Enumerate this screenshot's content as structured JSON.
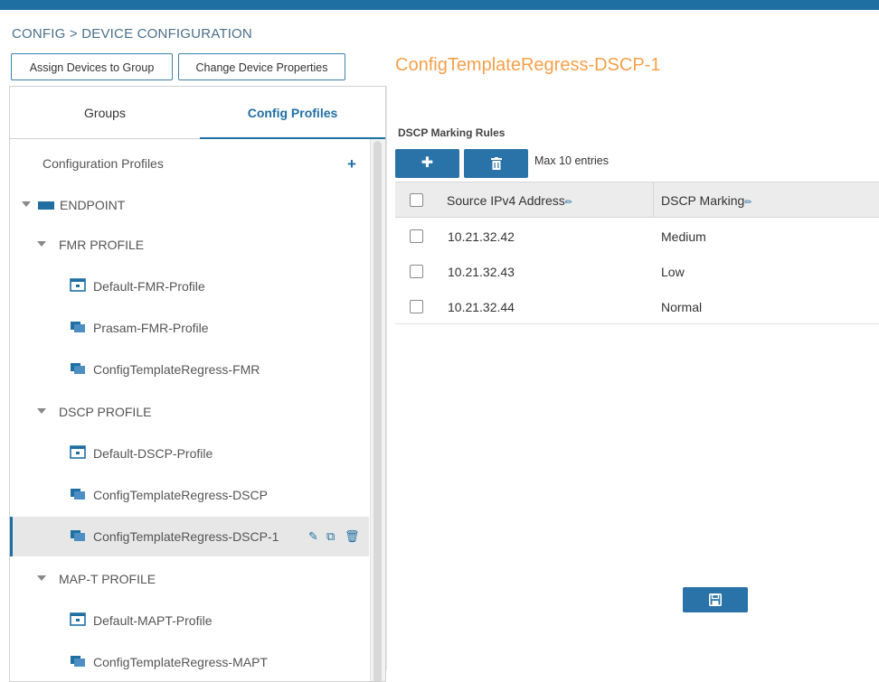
{
  "breadcrumb": "CONFIG > DEVICE CONFIGURATION",
  "toolbar": {
    "assign_label": "Assign Devices to Group",
    "change_label": "Change Device Properties"
  },
  "page_title": "ConfigTemplateRegress-DSCP-1",
  "tabs": {
    "groups": "Groups",
    "config_profiles": "Config Profiles"
  },
  "tree": {
    "header": "Configuration Profiles",
    "add_icon": "+",
    "root": "ENDPOINT",
    "items": [
      {
        "label": "FMR PROFILE",
        "kind": "group"
      },
      {
        "label": "Default-FMR-Profile",
        "kind": "default"
      },
      {
        "label": "Prasam-FMR-Profile",
        "kind": "custom"
      },
      {
        "label": "ConfigTemplateRegress-FMR",
        "kind": "custom"
      },
      {
        "label": "DSCP PROFILE",
        "kind": "group"
      },
      {
        "label": "Default-DSCP-Profile",
        "kind": "default"
      },
      {
        "label": "ConfigTemplateRegress-DSCP",
        "kind": "custom"
      },
      {
        "label": "ConfigTemplateRegress-DSCP-1",
        "kind": "custom",
        "selected": true
      },
      {
        "label": "MAP-T PROFILE",
        "kind": "group"
      },
      {
        "label": "Default-MAPT-Profile",
        "kind": "default"
      },
      {
        "label": "ConfigTemplateRegress-MAPT",
        "kind": "custom"
      }
    ]
  },
  "dscp": {
    "section_title": "DSCP Marking Rules",
    "max_entries": "Max 10 entries",
    "columns": [
      "Source IPv4 Address",
      "DSCP Marking"
    ],
    "rows": [
      {
        "ip": "10.21.32.42",
        "marking": "Medium"
      },
      {
        "ip": "10.21.32.43",
        "marking": "Low"
      },
      {
        "ip": "10.21.32.44",
        "marking": "Normal"
      }
    ]
  },
  "colors": {
    "accent": "#1f6fa3",
    "title": "#f5a04a",
    "button": "#2a73a8"
  },
  "icons": [
    "folder-icon",
    "default-profile-icon",
    "custom-profile-icon",
    "edit-icon",
    "copy-icon",
    "trash-icon",
    "plus-icon",
    "save-icon"
  ]
}
